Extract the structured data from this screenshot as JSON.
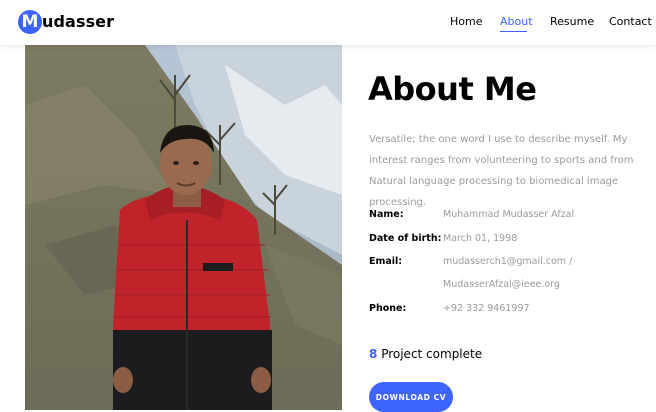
{
  "brand": {
    "logo_letter": "M",
    "logo_rest": "udasser"
  },
  "nav": {
    "items": [
      {
        "label": "Home"
      },
      {
        "label": "About"
      },
      {
        "label": "Resume"
      },
      {
        "label": "Contact"
      }
    ],
    "active": "About"
  },
  "about": {
    "title": "About Me",
    "description": "Versatile; the one word I use to describe myself. My interest ranges from volunteering to sports and from Natural language processing to biomedical image processing.",
    "info": {
      "name_label": "Name:",
      "name_value": "Muhammad Mudasser Afzal",
      "dob_label": "Date of birth:",
      "dob_value": "March 01, 1998",
      "email_label": "Email:",
      "email_value_1": "mudasserch1@gmail.com /",
      "email_value_2": "MudasserAfzal@ieee.org",
      "phone_label": "Phone:",
      "phone_value": "+92 332 9461997"
    },
    "projects_count": "8",
    "projects_label": "Project complete",
    "cv_button": "DOWNLOAD CV"
  },
  "colors": {
    "accent": "#3e64ff",
    "muted_text": "#9b9b9b",
    "jacket_red": "#c0232a"
  },
  "icons": {
    "brand_mark": "letter-circle-logo"
  }
}
